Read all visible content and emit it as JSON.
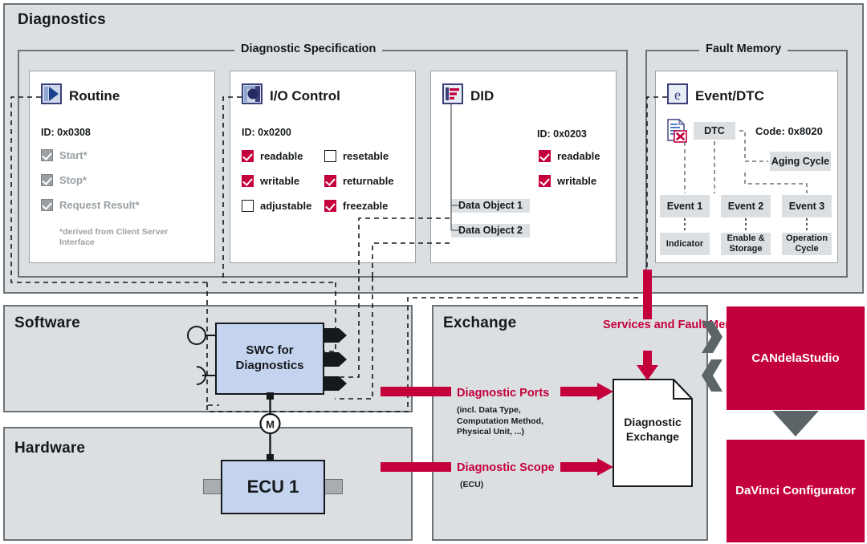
{
  "colors": {
    "accent_red": "#c4003c",
    "panel_bg": "#dcdfe1",
    "panel_border": "#6d7276",
    "blue_box": "#c5d4ee",
    "icon_blue": "#3b3f7a",
    "dim_gray": "#9aa0a4"
  },
  "diagnostics": {
    "title": "Diagnostics",
    "spec_group": {
      "legend": "Diagnostic Specification",
      "cards": [
        {
          "icon": "routine-play-icon",
          "title": "Routine",
          "id_label": "ID: 0x0308",
          "checkboxes": [
            {
              "label": "Start*",
              "state": "disabled-checked"
            },
            {
              "label": "Stop*",
              "state": "disabled-checked"
            },
            {
              "label": "Request Result*",
              "state": "disabled-checked"
            }
          ],
          "footnote": "*derived from Client Server Interface"
        },
        {
          "icon": "io-control-icon",
          "title": "I/O Control",
          "id_label": "ID: 0x0200",
          "checkboxes_left": [
            {
              "label": "readable",
              "state": "checked"
            },
            {
              "label": "writable",
              "state": "checked"
            },
            {
              "label": "adjustable",
              "state": "unchecked"
            }
          ],
          "checkboxes_right": [
            {
              "label": "resetable",
              "state": "unchecked"
            },
            {
              "label": "returnable",
              "state": "checked"
            },
            {
              "label": "freezable",
              "state": "checked"
            }
          ]
        },
        {
          "icon": "did-list-icon",
          "title": "DID",
          "id_label": "ID: 0x0203",
          "checkboxes": [
            {
              "label": "readable",
              "state": "checked"
            },
            {
              "label": "writable",
              "state": "checked"
            }
          ],
          "data_objects": [
            "Data Object 1",
            "Data Object 2"
          ]
        }
      ]
    },
    "fault_group": {
      "legend": "Fault Memory",
      "card": {
        "icon": "event-dtc-e-icon",
        "doc_icon": "document-error-icon",
        "title": "Event/DTC",
        "dtc_chip": "DTC",
        "code_label": "Code: 0x8020",
        "aging_chip": "Aging Cycle",
        "events": [
          "Event 1",
          "Event 2",
          "Event 3"
        ],
        "event_details": [
          "Indicator",
          "Enable & Storage",
          "Operation Cycle"
        ]
      }
    }
  },
  "software": {
    "title": "Software",
    "swc_box": "SWC for Diagnostics"
  },
  "hardware": {
    "title": "Hardware",
    "ecu_box": "ECU 1",
    "mapping_marker": "M"
  },
  "exchange": {
    "title": "Exchange",
    "services_label": "Services and Fault Memory",
    "diagnostic_ports_label": "Diagnostic Ports",
    "diagnostic_ports_sub": "(incl. Data Type,\nComputation Method,\nPhysical Unit, ...)",
    "diagnostic_ports_sub_lines": [
      "(incl. Data Type,",
      "Computation Method,",
      "Physical Unit, ...)"
    ],
    "diagnostic_scope_label": "Diagnostic Scope",
    "diagnostic_scope_sub": "(ECU)",
    "document_label": "Diagnostic Exchange"
  },
  "tools": {
    "candela": "CANdelaStudio",
    "davinci": "DaVinci Configurator"
  }
}
